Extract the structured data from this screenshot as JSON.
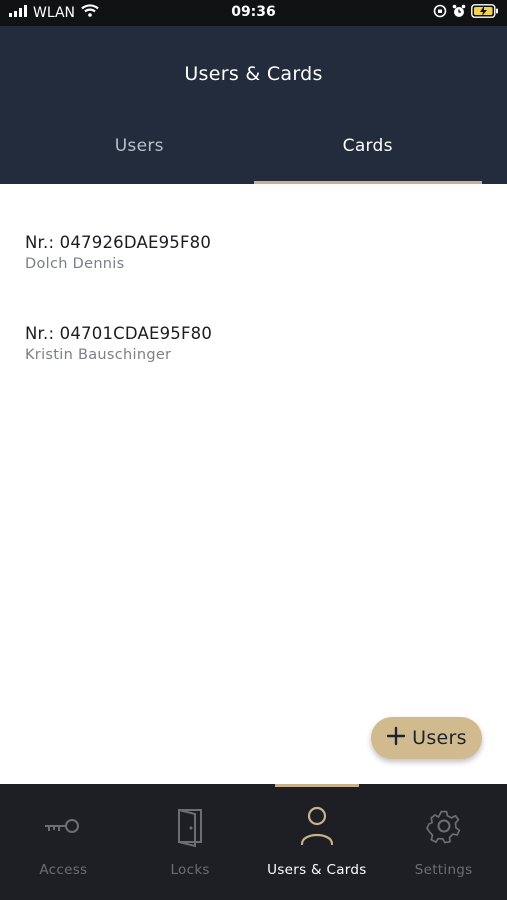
{
  "status_bar": {
    "carrier": "WLAN",
    "time": "09:36",
    "icons": [
      "signal-bars-icon",
      "wifi-icon",
      "orientation-lock-icon",
      "alarm-icon",
      "battery-charging-icon"
    ]
  },
  "header": {
    "title": "Users & Cards",
    "tabs": [
      {
        "label": "Users",
        "active": false
      },
      {
        "label": "Cards",
        "active": true
      }
    ]
  },
  "cards": [
    {
      "number": "Nr.: 047926DAE95F80",
      "owner": "Dolch Dennis"
    },
    {
      "number": "Nr.: 04701CDAE95F80",
      "owner": "Kristin Bauschinger"
    }
  ],
  "fab": {
    "label": "Users",
    "icon": "plus-icon"
  },
  "bottom_nav": [
    {
      "label": "Access",
      "icon": "key-icon",
      "active": false
    },
    {
      "label": "Locks",
      "icon": "door-icon",
      "active": false
    },
    {
      "label": "Users & Cards",
      "icon": "user-icon",
      "active": true
    },
    {
      "label": "Settings",
      "icon": "gear-icon",
      "active": false
    }
  ],
  "colors": {
    "header_bg": "#222c3c",
    "accent_gold": "#c9b18a",
    "fab_bg": "#d2ba8f",
    "nav_bg": "#1e1f24"
  }
}
